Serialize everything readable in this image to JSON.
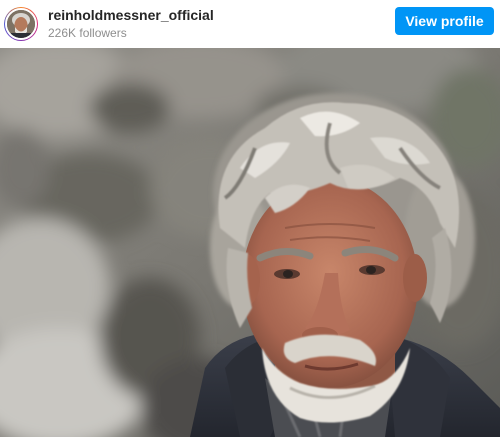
{
  "profile": {
    "username": "reinholdmessner_official",
    "followers": "226K followers",
    "view_profile_label": "View profile",
    "avatar_icon": "user-avatar"
  },
  "post": {
    "image_icon": "portrait-photo"
  },
  "colors": {
    "button_bg": "#0095f6",
    "username": "#262626",
    "followers": "#8e8e8e"
  }
}
